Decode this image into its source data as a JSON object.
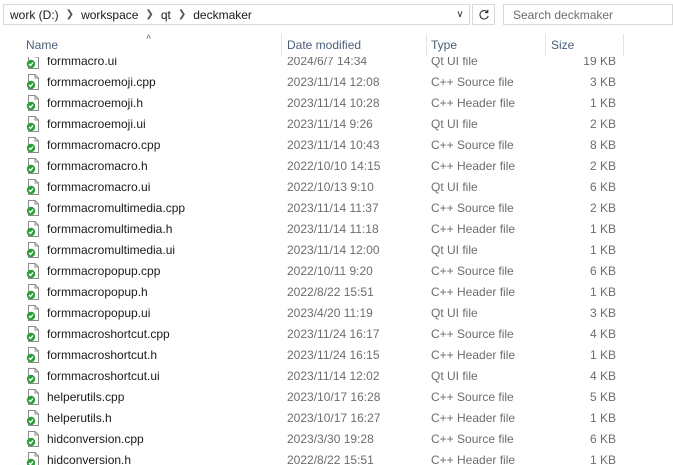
{
  "address_bar": {
    "crumbs": [
      "work (D:)",
      "workspace",
      "qt",
      "deckmaker"
    ]
  },
  "search": {
    "placeholder": "Search deckmaker"
  },
  "columns": {
    "name": "Name",
    "date_modified": "Date modified",
    "type": "Type",
    "size": "Size",
    "sorted_by": "name"
  },
  "files": [
    {
      "name": "formmacro.ui",
      "date": "2024/6/7 14:34",
      "type": "Qt UI file",
      "size": "19 KB",
      "icon": "ui-file-icon"
    },
    {
      "name": "formmacroemoji.cpp",
      "date": "2023/11/14 12:08",
      "type": "C++ Source file",
      "size": "3 KB",
      "icon": "cpp-file-icon"
    },
    {
      "name": "formmacroemoji.h",
      "date": "2023/11/14 10:28",
      "type": "C++ Header file",
      "size": "1 KB",
      "icon": "header-file-icon"
    },
    {
      "name": "formmacroemoji.ui",
      "date": "2023/11/14 9:26",
      "type": "Qt UI file",
      "size": "2 KB",
      "icon": "ui-file-icon"
    },
    {
      "name": "formmacromacro.cpp",
      "date": "2023/11/14 10:43",
      "type": "C++ Source file",
      "size": "8 KB",
      "icon": "cpp-file-icon"
    },
    {
      "name": "formmacromacro.h",
      "date": "2022/10/10 14:15",
      "type": "C++ Header file",
      "size": "2 KB",
      "icon": "header-file-icon"
    },
    {
      "name": "formmacromacro.ui",
      "date": "2022/10/13 9:10",
      "type": "Qt UI file",
      "size": "6 KB",
      "icon": "ui-file-icon"
    },
    {
      "name": "formmacromultimedia.cpp",
      "date": "2023/11/14 11:37",
      "type": "C++ Source file",
      "size": "2 KB",
      "icon": "cpp-file-icon"
    },
    {
      "name": "formmacromultimedia.h",
      "date": "2023/11/14 11:18",
      "type": "C++ Header file",
      "size": "1 KB",
      "icon": "header-file-icon"
    },
    {
      "name": "formmacromultimedia.ui",
      "date": "2023/11/14 12:00",
      "type": "Qt UI file",
      "size": "1 KB",
      "icon": "ui-file-icon"
    },
    {
      "name": "formmacropopup.cpp",
      "date": "2022/10/11 9:20",
      "type": "C++ Source file",
      "size": "6 KB",
      "icon": "cpp-file-icon"
    },
    {
      "name": "formmacropopup.h",
      "date": "2022/8/22 15:51",
      "type": "C++ Header file",
      "size": "1 KB",
      "icon": "header-file-icon"
    },
    {
      "name": "formmacropopup.ui",
      "date": "2023/4/20 11:19",
      "type": "Qt UI file",
      "size": "3 KB",
      "icon": "ui-file-icon"
    },
    {
      "name": "formmacroshortcut.cpp",
      "date": "2023/11/24 16:17",
      "type": "C++ Source file",
      "size": "4 KB",
      "icon": "cpp-file-icon"
    },
    {
      "name": "formmacroshortcut.h",
      "date": "2023/11/24 16:15",
      "type": "C++ Header file",
      "size": "1 KB",
      "icon": "header-file-icon"
    },
    {
      "name": "formmacroshortcut.ui",
      "date": "2023/11/14 12:02",
      "type": "Qt UI file",
      "size": "4 KB",
      "icon": "ui-file-icon"
    },
    {
      "name": "helperutils.cpp",
      "date": "2023/10/17 16:28",
      "type": "C++ Source file",
      "size": "5 KB",
      "icon": "cpp-file-icon"
    },
    {
      "name": "helperutils.h",
      "date": "2023/10/17 16:27",
      "type": "C++ Header file",
      "size": "1 KB",
      "icon": "header-file-icon"
    },
    {
      "name": "hidconversion.cpp",
      "date": "2023/3/30 19:28",
      "type": "C++ Source file",
      "size": "6 KB",
      "icon": "cpp-file-icon"
    },
    {
      "name": "hidconversion.h",
      "date": "2022/8/22 15:51",
      "type": "C++ Header file",
      "size": "1 KB",
      "icon": "header-file-icon"
    }
  ],
  "colors": {
    "header_text": "#4c607a",
    "icon_green": "#2e9e3a",
    "muted_text": "#6d6d6d"
  }
}
